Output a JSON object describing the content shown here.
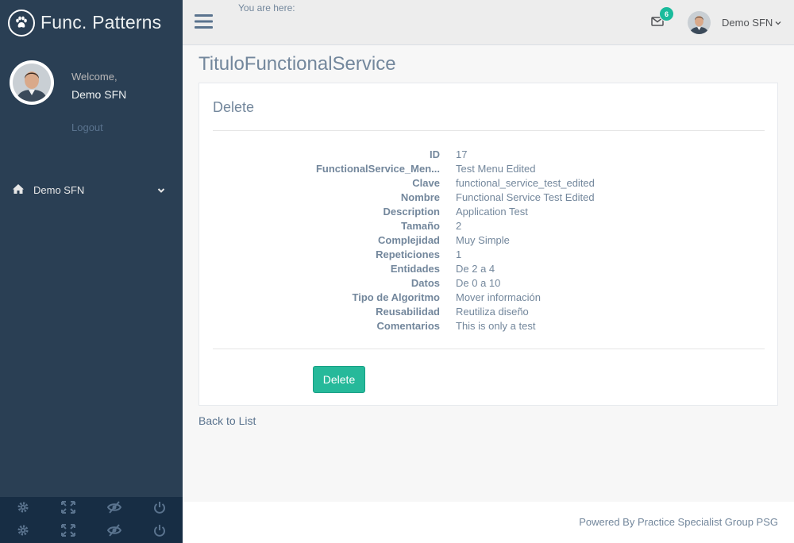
{
  "sidebar": {
    "brand_title": "Func. Patterns",
    "welcome": "Welcome,",
    "username": "Demo SFN",
    "logout": "Logout",
    "nav": [
      {
        "label": "Demo SFN",
        "icon": "home-icon"
      }
    ],
    "footer_icons": [
      "gear-icon",
      "fullscreen-icon",
      "eye-slash-icon",
      "power-icon"
    ]
  },
  "topnav": {
    "breadcrumb": "You are here:",
    "mail_count": "6",
    "user_name": "Demo SFN"
  },
  "page": {
    "title": "TituloFunctionalService",
    "panel_title": "Delete",
    "fields": [
      {
        "label": "ID",
        "value": "17"
      },
      {
        "label": "FunctionalService_Men...",
        "value": "Test Menu Edited"
      },
      {
        "label": "Clave",
        "value": "functional_service_test_edited"
      },
      {
        "label": "Nombre",
        "value": "Functional Service Test Edited"
      },
      {
        "label": "Description",
        "value": "Application Test"
      },
      {
        "label": "Tamaño",
        "value": "2"
      },
      {
        "label": "Complejidad",
        "value": "Muy Simple"
      },
      {
        "label": "Repeticiones",
        "value": "1"
      },
      {
        "label": "Entidades",
        "value": "De 2 a 4"
      },
      {
        "label": "Datos",
        "value": "De 0 a 10"
      },
      {
        "label": "Tipo de Algoritmo",
        "value": "Mover información"
      },
      {
        "label": "Reusabilidad",
        "value": "Reutiliza diseño"
      },
      {
        "label": "Comentarios",
        "value": "This is only a test"
      }
    ],
    "delete_label": "Delete",
    "back_link": "Back to List"
  },
  "footer": {
    "text": "Powered By Practice Specialist Group PSG"
  },
  "colors": {
    "sidebar_bg": "#2A3F54",
    "sidebar_footer_bg": "#172D44",
    "accent": "#1ABB9C",
    "button": "#26B99A",
    "text": "#73879C"
  }
}
